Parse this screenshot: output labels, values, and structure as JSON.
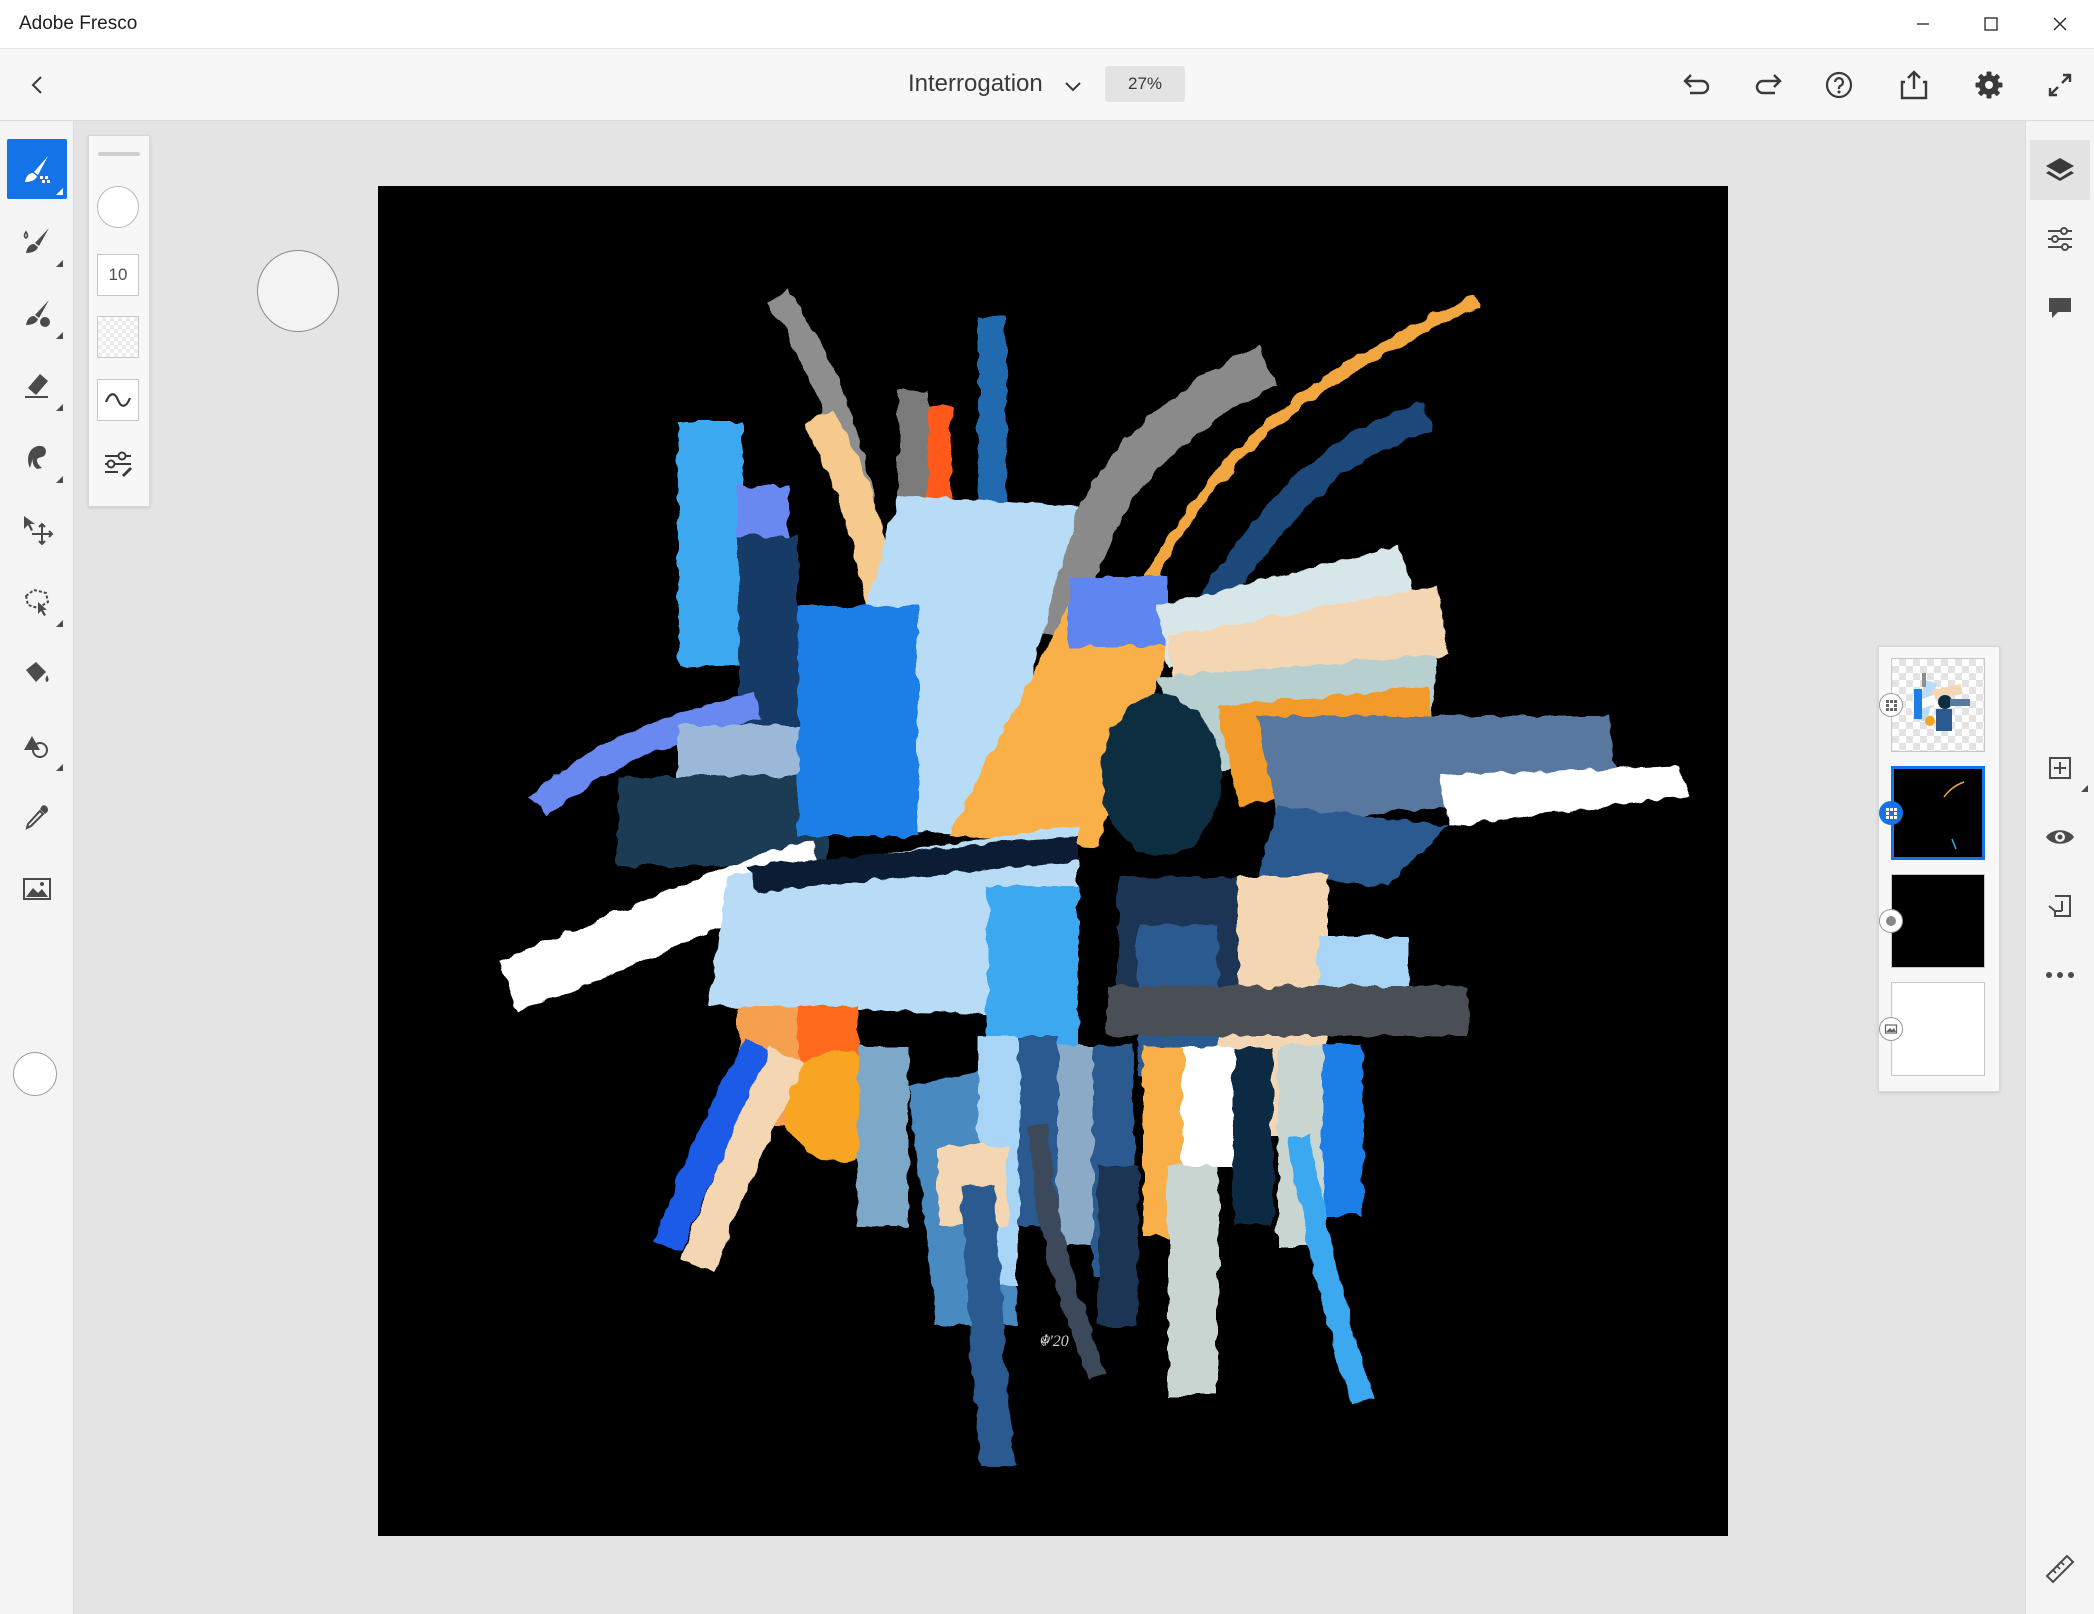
{
  "window": {
    "title": "Adobe Fresco",
    "controls": [
      "minimize",
      "maximize",
      "close"
    ]
  },
  "header": {
    "document_title": "Interrogation",
    "zoom": "27%",
    "icons": [
      "back-arrow-icon",
      "chevron-down-icon",
      "undo-icon",
      "redo-icon",
      "help-icon",
      "share-icon",
      "gear-icon",
      "fullscreen-icon"
    ]
  },
  "left_toolbar": {
    "tools": [
      "pixel-brush",
      "live-brush",
      "vector-brush",
      "eraser",
      "smudge",
      "transform",
      "selection",
      "fill",
      "shapes",
      "eyedropper",
      "place-image"
    ],
    "active_tool": "pixel-brush",
    "color": "#ffffff"
  },
  "brush_panel": {
    "size": "10"
  },
  "layers": {
    "count": 4,
    "selected_index": 1
  },
  "right_toolbar": {
    "tools": [
      "layers",
      "layer-properties",
      "comments",
      "add-layer",
      "visibility",
      "layer-actions",
      "more-options",
      "ruler"
    ]
  },
  "colors": {
    "accent": "#1473e6",
    "canvas": "#000000"
  }
}
